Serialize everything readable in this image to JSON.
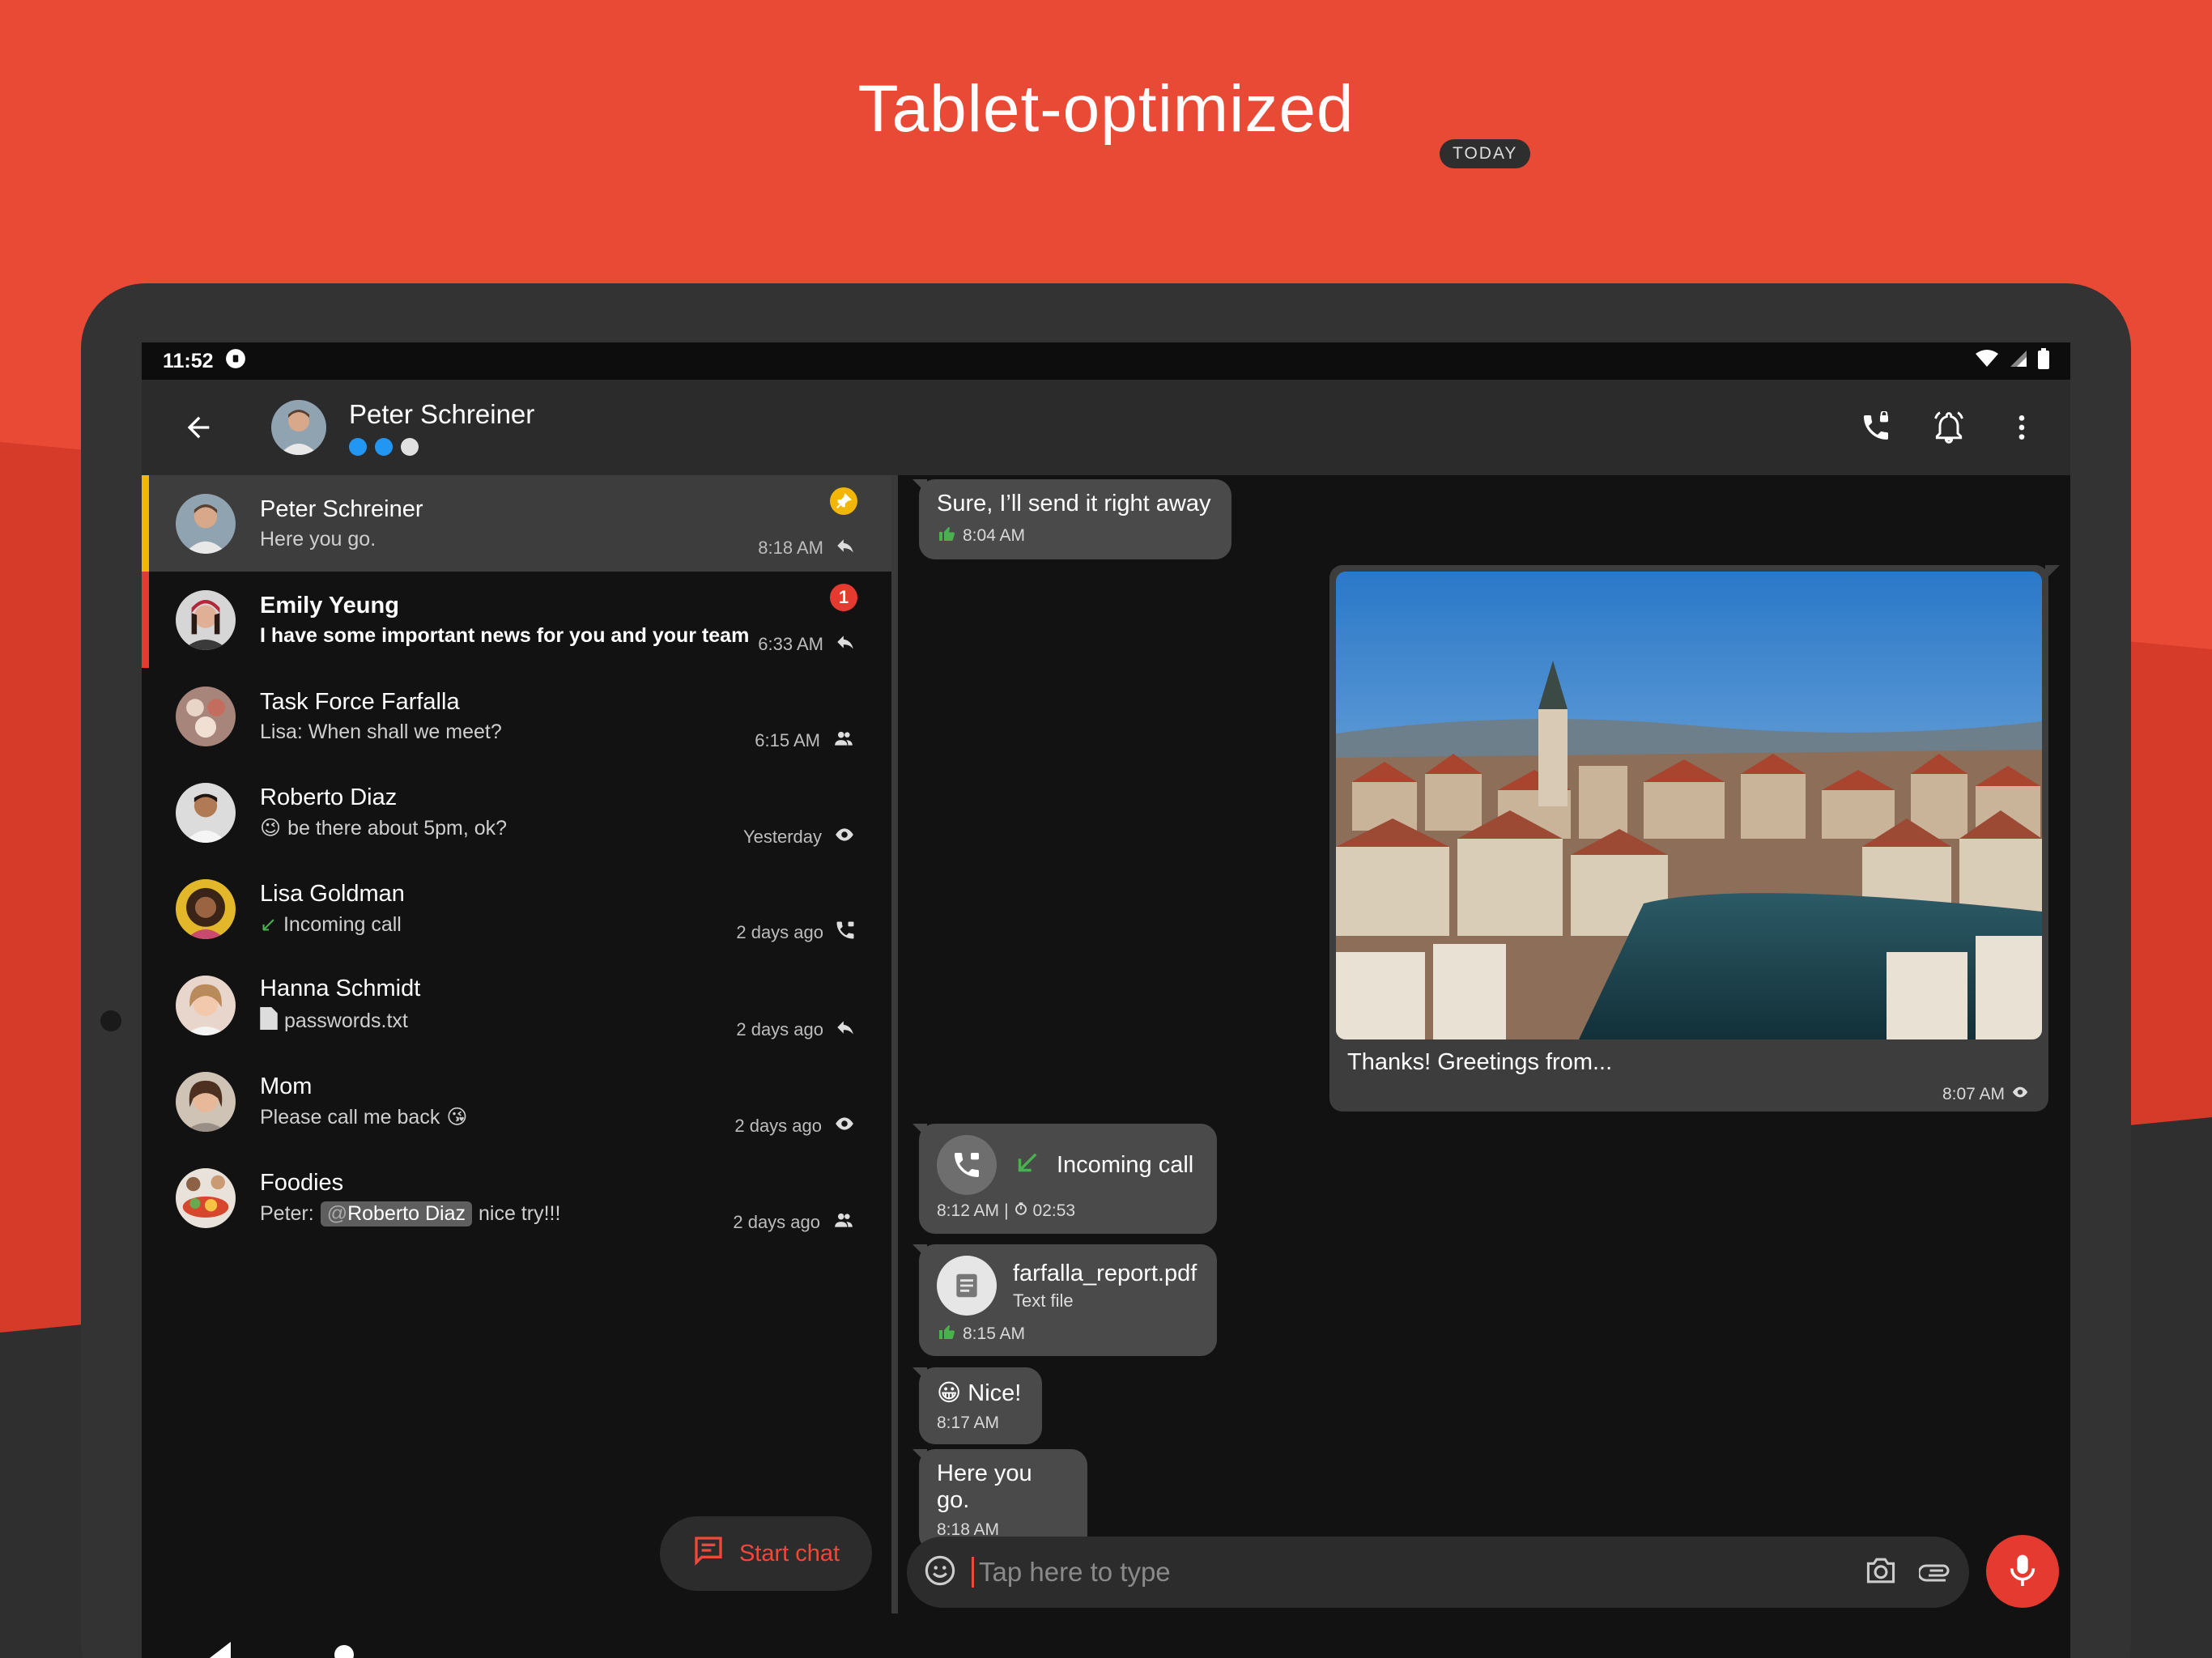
{
  "headline": "Tablet-optimized",
  "status": {
    "time": "11:52"
  },
  "appbar": {
    "contact_name": "Peter Schreiner",
    "trust_dots": [
      "#2196f3",
      "#2196f3",
      "#e0e0e0"
    ]
  },
  "conversations": [
    {
      "name": "Peter Schreiner",
      "snippet": "Here you go.",
      "time": "8:18 AM",
      "status_icon": "reply-icon",
      "badge": "pin",
      "stripe": "#f2b705",
      "selected": true
    },
    {
      "name": "Emily Yeung",
      "snippet": "I have some important news for you and your team",
      "time": "6:33 AM",
      "status_icon": "reply-icon",
      "badge": "1",
      "stripe": "#e53a30",
      "unread": true
    },
    {
      "name": "Task Force Farfalla",
      "snippet": "Lisa: When shall we meet?",
      "time": "6:15 AM",
      "status_icon": "group-icon"
    },
    {
      "name": "Roberto Diaz",
      "snippet_emoji": "😉",
      "snippet": "be there about 5pm, ok?",
      "time": "Yesterday",
      "status_icon": "eye-icon"
    },
    {
      "name": "Lisa Goldman",
      "snippet_prefix": "↙",
      "snippet": "Incoming call",
      "time": "2 days ago",
      "status_icon": "phone-icon"
    },
    {
      "name": "Hanna Schmidt",
      "snippet_prefix": "file",
      "snippet": "passwords.txt",
      "time": "2 days ago",
      "status_icon": "reply-icon"
    },
    {
      "name": "Mom",
      "snippet": "Please call me back",
      "snippet_suffix": "😘",
      "time": "2 days ago",
      "status_icon": "eye-icon"
    },
    {
      "name": "Foodies",
      "snippet_sender": "Peter:",
      "mention_at": "@",
      "mention": "Roberto Diaz",
      "snippet": "nice try!!!",
      "time": "2 days ago",
      "status_icon": "group-icon"
    }
  ],
  "fab": {
    "label": "Start chat"
  },
  "chat": {
    "date_chip": "TODAY",
    "msg1": {
      "text": "Sure, I’ll send it right away",
      "time": "8:04 AM"
    },
    "image_msg": {
      "caption": "Thanks! Greetings from...",
      "time": "8:07 AM"
    },
    "call_msg": {
      "text": "Incoming call",
      "time": "8:12 AM",
      "duration": "02:53",
      "separator": "|"
    },
    "file_msg": {
      "filename": "farfalla_report.pdf",
      "filetype": "Text file",
      "time": "8:15 AM"
    },
    "nice_msg": {
      "emoji": "😀",
      "text": "Nice!",
      "time": "8:17 AM"
    },
    "last_msg": {
      "text": "Here you go.",
      "time": "8:18 AM"
    }
  },
  "composer": {
    "placeholder": "Tap here to type"
  }
}
